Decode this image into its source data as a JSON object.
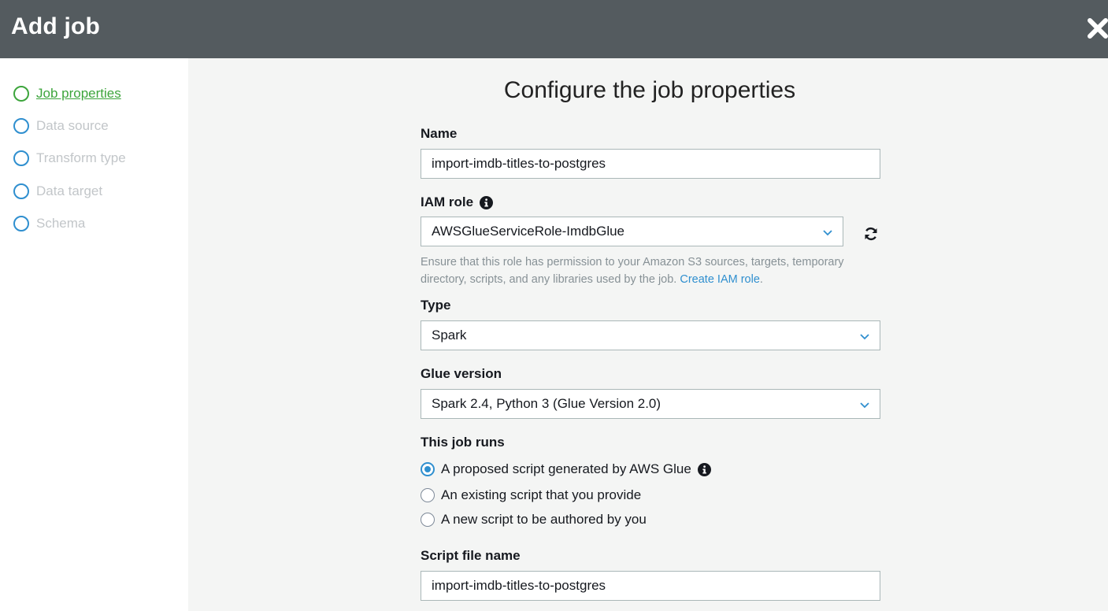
{
  "header": {
    "title": "Add job"
  },
  "steps": [
    {
      "label": "Job properties",
      "active": true
    },
    {
      "label": "Data source",
      "active": false
    },
    {
      "label": "Transform type",
      "active": false
    },
    {
      "label": "Data target",
      "active": false
    },
    {
      "label": "Schema",
      "active": false
    }
  ],
  "main": {
    "heading": "Configure the job properties",
    "name_label": "Name",
    "name_value": "import-imdb-titles-to-postgres",
    "iam_label": "IAM role",
    "iam_value": "AWSGlueServiceRole-ImdbGlue",
    "iam_help": "Ensure that this role has permission to your Amazon S3 sources, targets, temporary directory, scripts, and any libraries used by the job.",
    "iam_help_link": "Create IAM role",
    "type_label": "Type",
    "type_value": "Spark",
    "glue_label": "Glue version",
    "glue_value": "Spark 2.4, Python 3 (Glue Version 2.0)",
    "runs_label": "This job runs",
    "runs_options": [
      {
        "label": "A proposed script generated by AWS Glue",
        "checked": true
      },
      {
        "label": "An existing script that you provide",
        "checked": false
      },
      {
        "label": "A new script to be authored by you",
        "checked": false
      }
    ],
    "script_label": "Script file name",
    "script_value": "import-imdb-titles-to-postgres"
  },
  "icons": {
    "close": "close-icon",
    "info": "info-icon",
    "refresh": "refresh-icon",
    "chevron": "chevron-down-icon"
  },
  "colors": {
    "header_bg": "#545b5f",
    "active_step": "#3da53c",
    "accent": "#2f8fcf",
    "muted_text": "#879196"
  }
}
